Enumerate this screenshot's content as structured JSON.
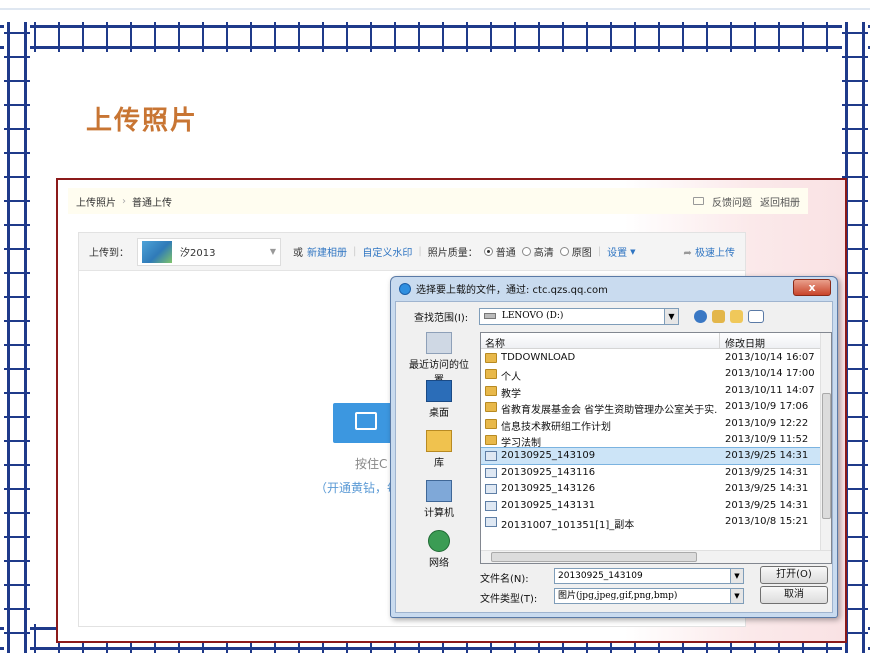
{
  "slide": {
    "title": "上传照片"
  },
  "qzone": {
    "breadcrumb": [
      "上传照片",
      "普通上传"
    ],
    "feedback_label": "反馈问题",
    "back_label": "返回相册",
    "upload_to_label": "上传到：",
    "album_name": "汐2013",
    "or_label": "或",
    "new_album_label": "新建相册",
    "watermark_label": "自定义水印",
    "quality_label": "照片质量：",
    "quality_options": [
      "普通",
      "高清",
      "原图"
    ],
    "settings_label": "设置",
    "fast_upload_label": "极速上传",
    "hint_text": "按住C",
    "hint_text2": "（开通黄钻，每"
  },
  "dialog": {
    "title": "选择要上载的文件，通过: ctc.qzs.qq.com",
    "close_label": "x",
    "look_in_label": "查找范围(I):",
    "look_in_value": "LENOVO (D:)",
    "places": [
      "最近访问的位置",
      "桌面",
      "库",
      "计算机",
      "网络"
    ],
    "columns": [
      "名称",
      "修改日期"
    ],
    "files": [
      {
        "name": "TDDOWNLOAD",
        "date": "2013/10/14 16:07",
        "type": "folder"
      },
      {
        "name": "个人",
        "date": "2013/10/14 17:00",
        "type": "folder"
      },
      {
        "name": "教学",
        "date": "2013/10/11 14:07",
        "type": "folder"
      },
      {
        "name": "省教育发展基金会 省学生资助管理办公室关于实...",
        "date": "2013/10/9 17:06",
        "type": "folder"
      },
      {
        "name": "信息技术教研组工作计划",
        "date": "2013/10/9 12:22",
        "type": "folder"
      },
      {
        "name": "学习法制",
        "date": "2013/10/9 11:52",
        "type": "folder"
      },
      {
        "name": "20130925_143109",
        "date": "2013/9/25 14:31",
        "type": "image",
        "selected": true
      },
      {
        "name": "20130925_143116",
        "date": "2013/9/25 14:31",
        "type": "image"
      },
      {
        "name": "20130925_143126",
        "date": "2013/9/25 14:31",
        "type": "image"
      },
      {
        "name": "20130925_143131",
        "date": "2013/9/25 14:31",
        "type": "image"
      },
      {
        "name": "20131007_101351[1]_副本",
        "date": "2013/10/8 15:21",
        "type": "image"
      }
    ],
    "filename_label": "文件名(N):",
    "filename_value": "20130925_143109",
    "filetype_label": "文件类型(T):",
    "filetype_value": "图片(jpg,jpeg,gif,png,bmp)",
    "open_label": "打开(O)",
    "cancel_label": "取消"
  }
}
